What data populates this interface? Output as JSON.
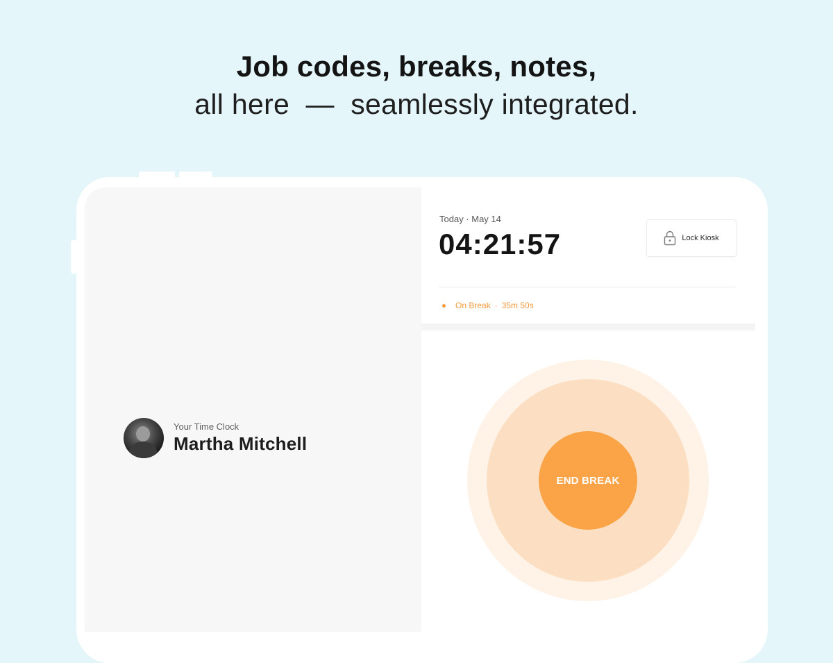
{
  "headline": {
    "title": "Job codes, breaks, notes,",
    "subtitle": "all here  —  seamlessly integrated."
  },
  "user": {
    "caption": "Your Time Clock",
    "name": "Martha Mitchell"
  },
  "status": {
    "date": "Today · May 14",
    "time": "04:21:57",
    "lock_label": "Lock Kiosk",
    "break_label": "On Break",
    "separator": "·",
    "break_duration": "35m 50s"
  },
  "action": {
    "end_break_label": "END BREAK"
  },
  "colors": {
    "background": "#e4f6fa",
    "accent": "#fba447",
    "accent_text": "#f39a3d",
    "ring_light": "#fff3e8",
    "ring_mid": "#fcdfc2"
  },
  "icons": {
    "lock": "lock-icon",
    "avatar": "user-avatar-photo"
  }
}
